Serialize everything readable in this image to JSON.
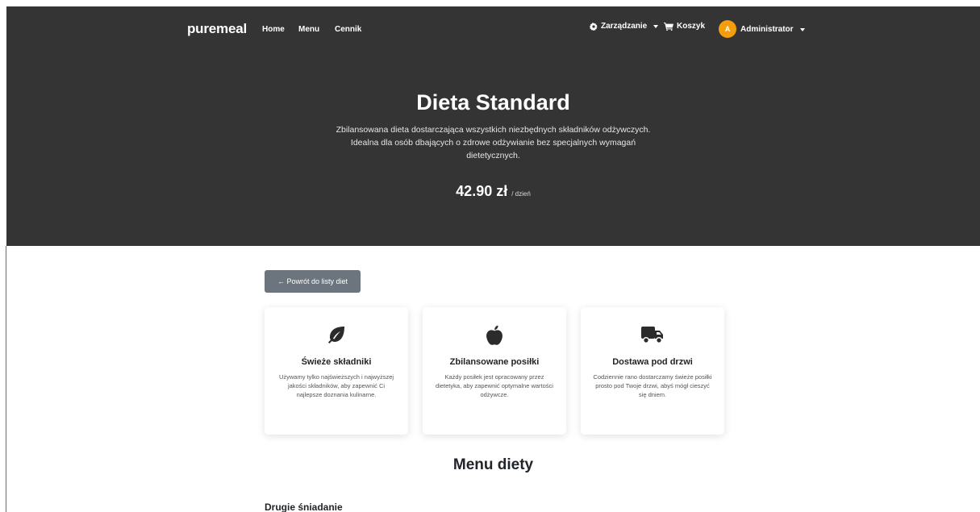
{
  "navbar": {
    "brand": "puremeal",
    "links": [
      "Home",
      "Menu",
      "Cennik"
    ],
    "manage_label": "Zarządzanie",
    "cart_label": "Koszyk",
    "avatar_letter": "A",
    "user_label": "Administrator"
  },
  "hero": {
    "title": "Dieta Standard",
    "description": "Zbilansowana dieta dostarczająca wszystkich niezbędnych składników odżywczych. Idealna dla osób dbających o zdrowe odżywianie bez specjalnych wymagań dietetycznych.",
    "price": "42.90 zł",
    "price_unit": "/ dzień"
  },
  "back_button": "← Powrót do listy diet",
  "features": [
    {
      "icon": "leaf-icon",
      "title": "Świeże składniki",
      "description": "Używamy tylko najświeższych i najwyższej jakości składników, aby zapewnić Ci najlepsze doznania kulinarne."
    },
    {
      "icon": "apple-icon",
      "title": "Zbilansowane posiłki",
      "description": "Każdy posiłek jest opracowany przez dietetyka, aby zapewnić optymalne wartości odżywcze."
    },
    {
      "icon": "truck-icon",
      "title": "Dostawa pod drzwi",
      "description": "Codziennie rano dostarczamy świeże posiłki prosto pod Twoje drzwi, abyś mógł cieszyć się dniem."
    }
  ],
  "menu_section": {
    "title": "Menu diety",
    "first_meal": "Drugie śniadanie"
  },
  "colors": {
    "navbar_bg": "#343434",
    "avatar": "#f59e0b",
    "button_secondary": "#6c757d"
  }
}
